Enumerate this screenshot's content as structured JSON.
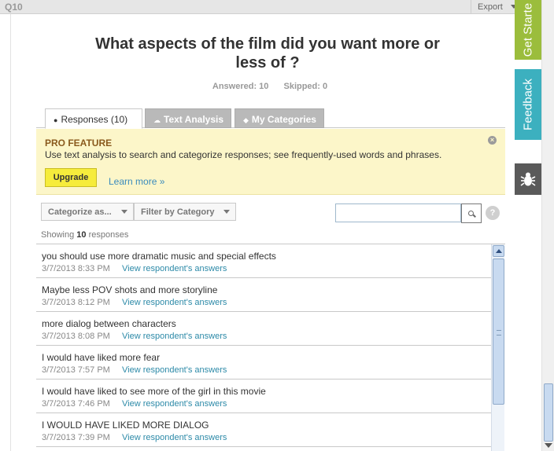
{
  "question": {
    "number": "Q10",
    "export_label": "Export",
    "title": "What aspects of the film did you want more or less of ?",
    "answered": "Answered: 10",
    "skipped": "Skipped: 0"
  },
  "tabs": [
    {
      "label": "Responses",
      "count": "(10)",
      "icon": "speech-bubble-icon"
    },
    {
      "label": "Text Analysis",
      "icon": "cloud-icon"
    },
    {
      "label": "My Categories",
      "icon": "tag-icon"
    }
  ],
  "pro_feature": {
    "title": "PRO FEATURE",
    "description": "Use text analysis to search and categorize responses; see frequently-used words and phrases.",
    "upgrade_label": "Upgrade",
    "learn_more": "Learn more »"
  },
  "toolbar": {
    "categorize_label": "Categorize as...",
    "filter_label": "Filter by Category",
    "search_value": "",
    "help_label": "?"
  },
  "showing": {
    "prefix": "Showing ",
    "count": "10",
    "suffix": " responses"
  },
  "responses": [
    {
      "text": "you should use more dramatic music and special effects",
      "date": "3/7/2013 8:33 PM",
      "link": "View respondent's answers"
    },
    {
      "text": "Maybe less POV shots and more storyline",
      "date": "3/7/2013 8:12 PM",
      "link": "View respondent's answers"
    },
    {
      "text": "more dialog between characters",
      "date": "3/7/2013 8:08 PM",
      "link": "View respondent's answers"
    },
    {
      "text": "I would have liked more fear",
      "date": "3/7/2013 7:57 PM",
      "link": "View respondent's answers"
    },
    {
      "text": "I would have liked to see more of the girl in this movie",
      "date": "3/7/2013 7:46 PM",
      "link": "View respondent's answers"
    },
    {
      "text": "I WOULD HAVE LIKED MORE DIALOG",
      "date": "3/7/2013 7:39 PM",
      "link": "View respondent's answers"
    }
  ],
  "side_tabs": {
    "get_started": "Get Starte",
    "feedback": "Feedback",
    "bug_icon": "bug-icon"
  },
  "colors": {
    "accent_green": "#9bbd3c",
    "accent_teal": "#3cb0bf",
    "pro_bg": "#fcf6c9",
    "upgrade_yellow": "#f6ec3c",
    "link_blue": "#2d8aa8"
  }
}
